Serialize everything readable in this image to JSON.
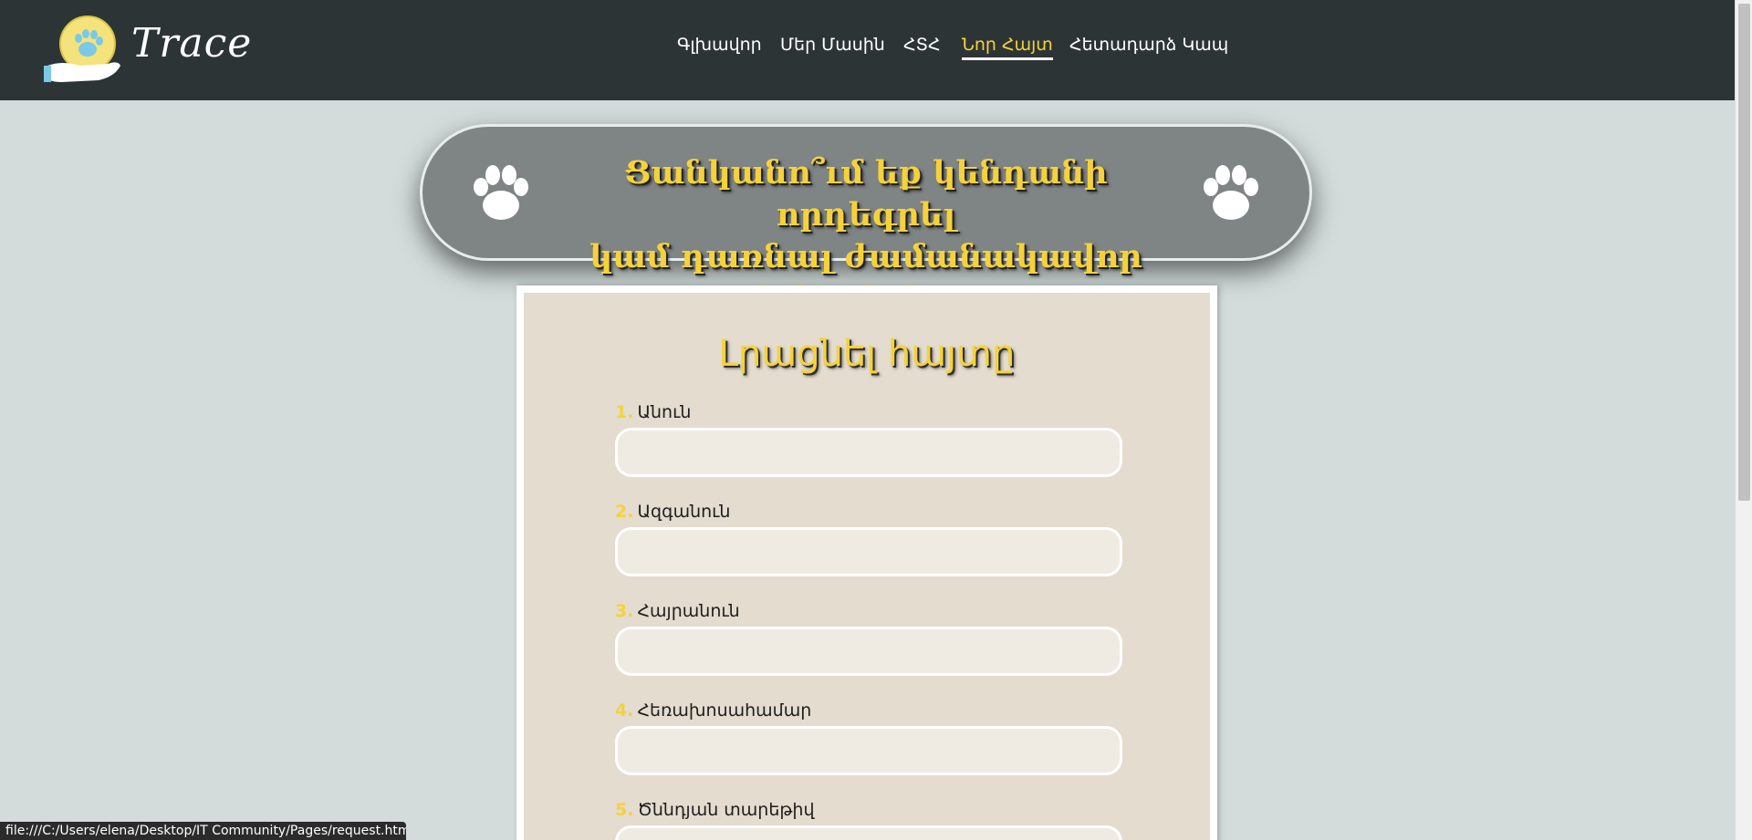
{
  "header": {
    "logo_text": "Trace",
    "nav": [
      {
        "label": "Գլխավոր"
      },
      {
        "label": "Մեր Մասին"
      },
      {
        "label": "ՀՏՀ"
      },
      {
        "label": "Նոր Հայտ",
        "active": true
      },
      {
        "label": "Հետադարձ Կապ"
      }
    ]
  },
  "banner": {
    "line1": "Ցանկանո՞ւմ եք կենդանի որդեգրել",
    "line2": "կամ դառնալ ժամանակավոր խնամակալ"
  },
  "form": {
    "title": "Լրացնել հայտը",
    "fields": [
      {
        "num": "1.",
        "label": "Անուն",
        "value": ""
      },
      {
        "num": "2.",
        "label": "Ազգանուն",
        "value": ""
      },
      {
        "num": "3.",
        "label": "Հայրանուն",
        "value": ""
      },
      {
        "num": "4.",
        "label": "Հեռախոսահամար",
        "value": ""
      },
      {
        "num": "5.",
        "label": "Ծննդյան տարեթիվ",
        "value": ""
      }
    ]
  },
  "statusbar": {
    "url": "file:///C:/Users/elena/Desktop/IT Community/Pages/request.html"
  },
  "colors": {
    "header_bg": "#2d3436",
    "page_bg": "#d3dcdb",
    "accent_yellow": "#f5d23a",
    "banner_bg": "#7f8485",
    "card_bg": "#e3dccf"
  },
  "icons": {
    "logo": "hand-holding-paw-icon",
    "banner_left": "paw-icon",
    "banner_right": "paw-icon"
  }
}
